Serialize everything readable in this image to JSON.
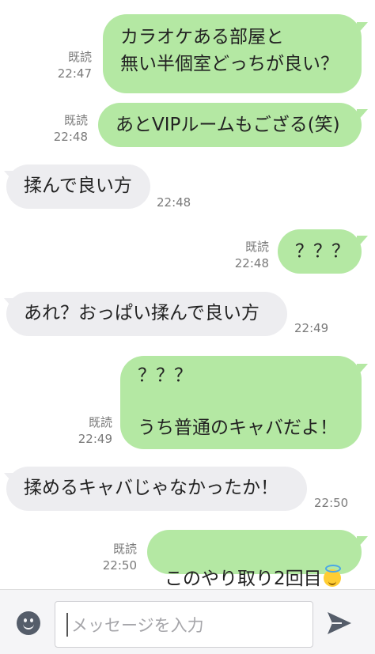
{
  "messages": [
    {
      "id": "m1",
      "side": "out",
      "text": "カラオケある部屋と\n無い半個室どっちが良い？",
      "read": "既読",
      "time": "22:47"
    },
    {
      "id": "m2",
      "side": "out",
      "text": "あとVIPルームもござる(笑)",
      "read": "既読",
      "time": "22:48"
    },
    {
      "id": "m3",
      "side": "in",
      "text": "揉んで良い方",
      "time": "22:48"
    },
    {
      "id": "m4",
      "side": "out",
      "text": "？？？",
      "read": "既読",
      "time": "22:48"
    },
    {
      "id": "m5",
      "side": "in",
      "text": "あれ？おっぱい揉んで良い方",
      "time": "22:49"
    },
    {
      "id": "m6",
      "side": "out",
      "text": "？？？\n\nうち普通のキャバだよ！",
      "read": "既読",
      "time": "22:49"
    },
    {
      "id": "m7",
      "side": "in",
      "text": "揉めるキャバじゃなかったか！",
      "time": "22:50"
    },
    {
      "id": "m8",
      "side": "out",
      "text": "このやり取り2回目",
      "emoji": "halo-smile-emoji",
      "read": "既読",
      "time": "22:50"
    }
  ],
  "composer": {
    "placeholder": "メッセージを入力",
    "value": "",
    "left_icon": "smile-icon",
    "right_icon": "send-icon"
  },
  "colors": {
    "outgoing_bubble": "#b4e8a3",
    "incoming_bubble": "#ededf0",
    "meta_text": "#7a7a7a"
  }
}
